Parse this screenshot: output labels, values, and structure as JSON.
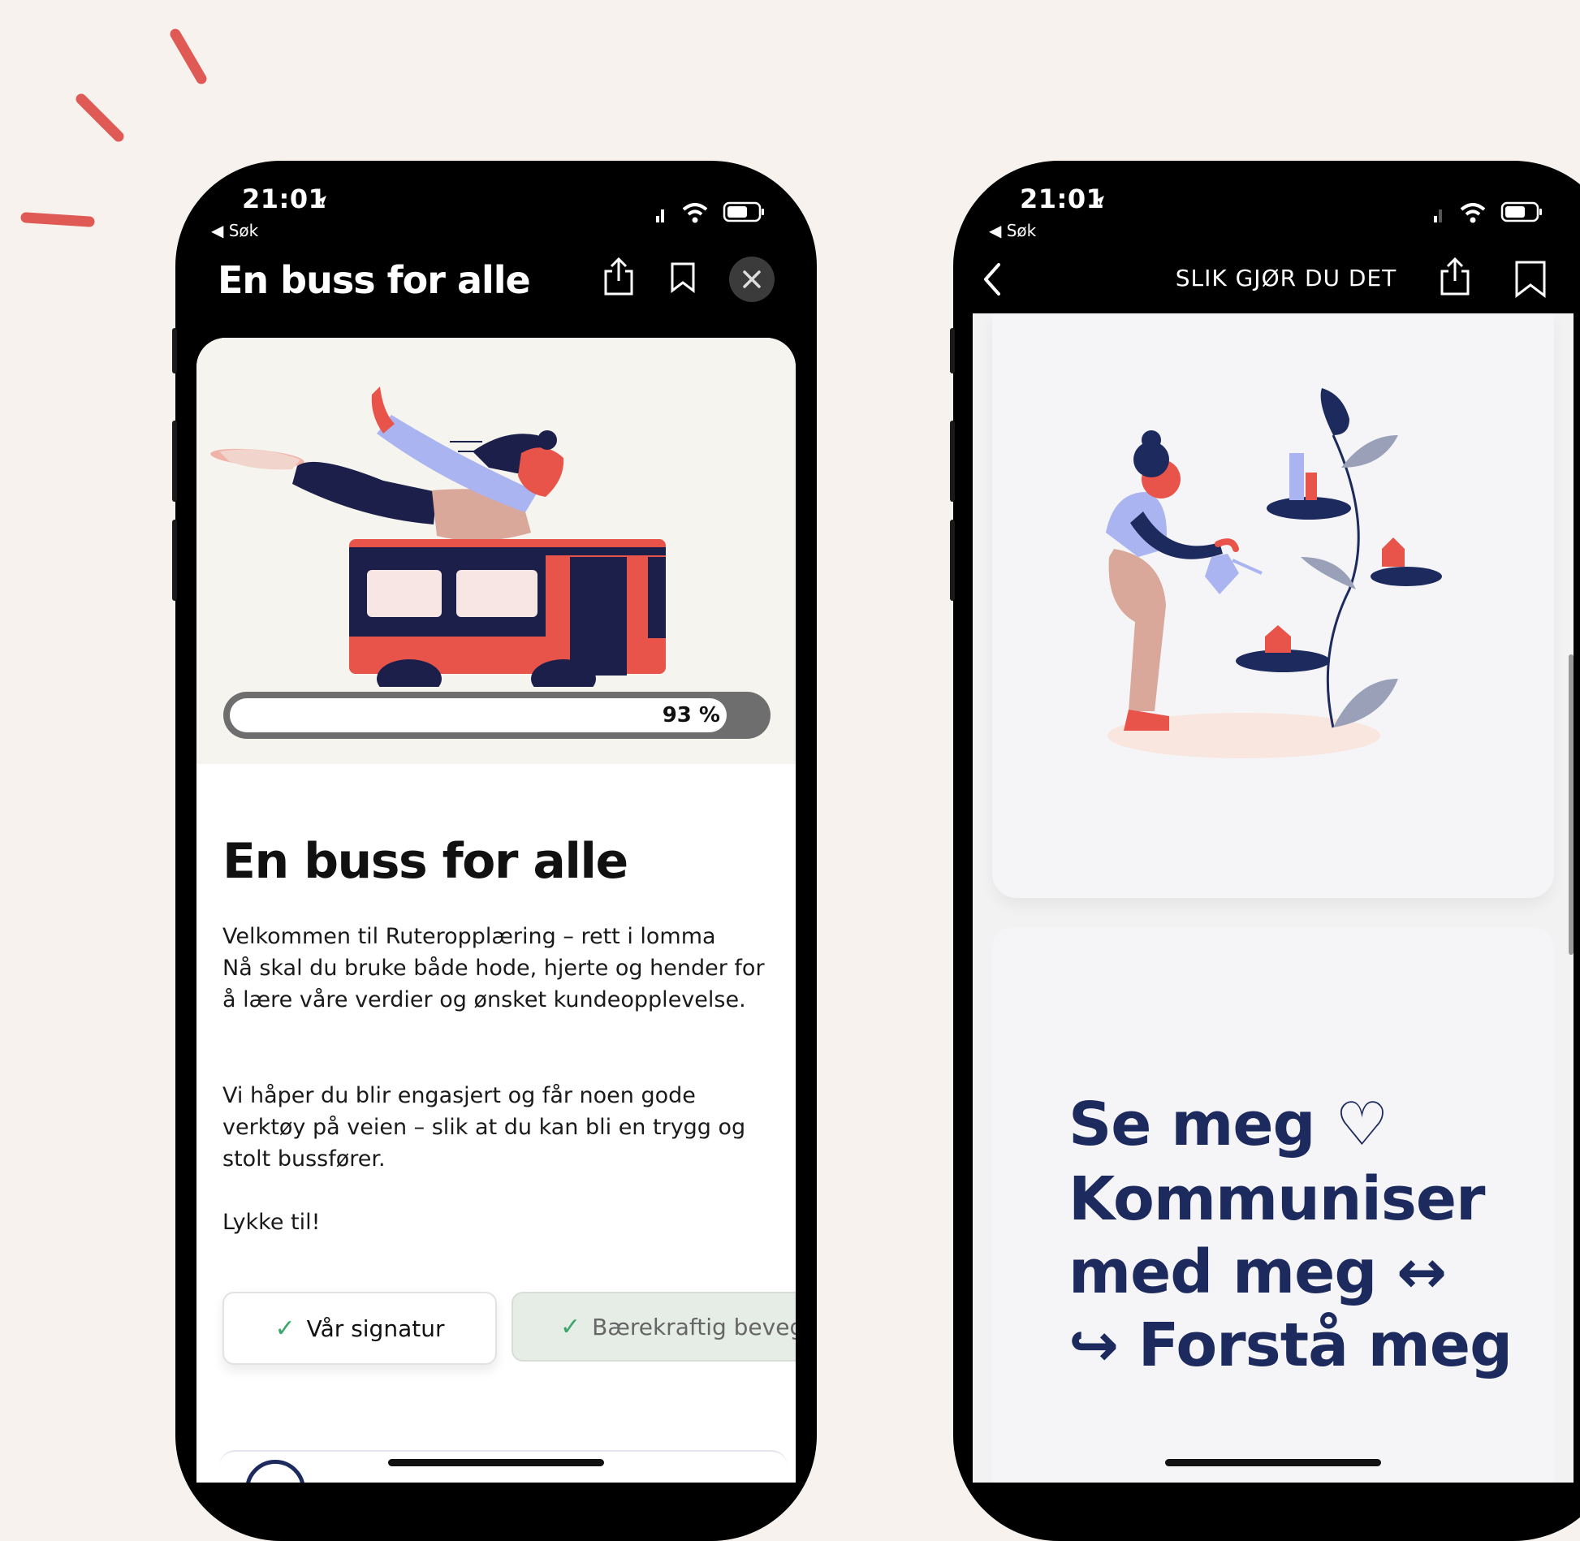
{
  "left_phone": {
    "status": {
      "time": "21:01",
      "back_app": "◀ Søk"
    },
    "header": {
      "title": "En buss for alle"
    },
    "progress": {
      "percent": 93,
      "label": "93 %"
    },
    "article": {
      "title": "En buss for alle",
      "paragraphs": [
        "Velkommen til Ruteropplæring – rett i lomma Nå skal du bruke både hode, hjerte og hender for å lære våre verdier og ønsket kundeopplevelse.",
        "Vi håper du blir engasjert og får noen gode verktøy på veien – slik at du kan bli en trygg og stolt bussfører.",
        "Lykke til!"
      ]
    },
    "chips": [
      {
        "label": "Vår signatur",
        "done": true
      },
      {
        "label": "Bærekraftig bevege",
        "done": true
      }
    ]
  },
  "right_phone": {
    "status": {
      "time": "21:01",
      "back_app": "◀ Søk"
    },
    "header": {
      "title": "SLIK GJØR DU DET"
    },
    "text_card": {
      "lines": [
        "Se meg ♡",
        "Kommuniser",
        "med meg ↔",
        "↪ Forstå meg"
      ]
    }
  },
  "colors": {
    "background": "#f7f2ed",
    "accent_red": "#e8544a",
    "navy": "#1c2a5e",
    "lavender": "#aab4f0",
    "check_green": "#3aa66a"
  }
}
